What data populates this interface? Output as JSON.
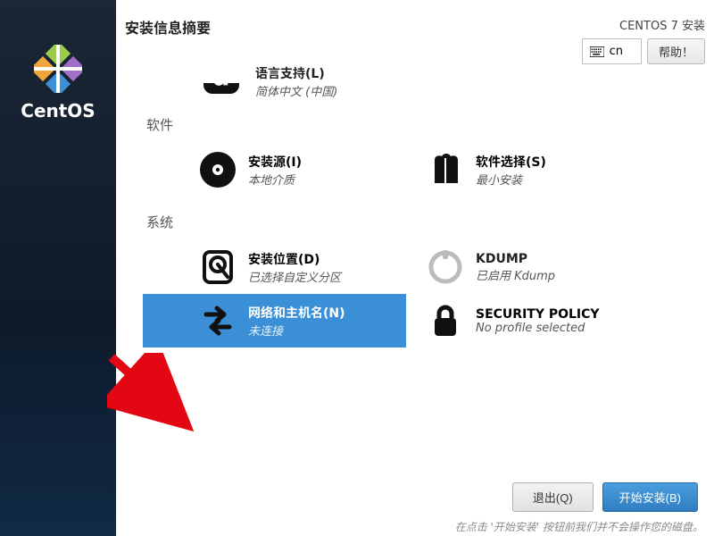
{
  "sidebar": {
    "brand": "CentOS"
  },
  "header": {
    "title": "安装信息摘要",
    "product": "CENTOS 7 安装",
    "keyboard_layout": "cn",
    "help_label": "帮助！"
  },
  "partial_top_item": {
    "title": "语言支持(L)",
    "subtitle": "简体中文 (中国)"
  },
  "categories": [
    {
      "label": "软件",
      "items": [
        {
          "id": "install-source",
          "icon": "disc-icon",
          "title": "安装源(I)",
          "subtitle": "本地介质"
        },
        {
          "id": "software-selection",
          "icon": "package-icon",
          "title": "软件选择(S)",
          "subtitle": "最小安装"
        }
      ]
    },
    {
      "label": "系统",
      "items": [
        {
          "id": "install-dest",
          "icon": "disk-icon",
          "title": "安装位置(D)",
          "subtitle": "已选择自定义分区"
        },
        {
          "id": "kdump",
          "icon": "kdump-icon",
          "title": "KDUMP",
          "subtitle": "已启用 Kdump"
        },
        {
          "id": "network",
          "icon": "network-icon",
          "title": "网络和主机名(N)",
          "subtitle": "未连接",
          "selected": true
        },
        {
          "id": "secpol",
          "icon": "lock-icon",
          "title": "SECURITY POLICY",
          "subtitle": "No profile selected"
        }
      ]
    }
  ],
  "footer": {
    "quit_label": "退出(Q)",
    "begin_label": "开始安装(B)",
    "hint": "在点击 '开始安装' 按钮前我们并不会操作您的磁盘。"
  }
}
